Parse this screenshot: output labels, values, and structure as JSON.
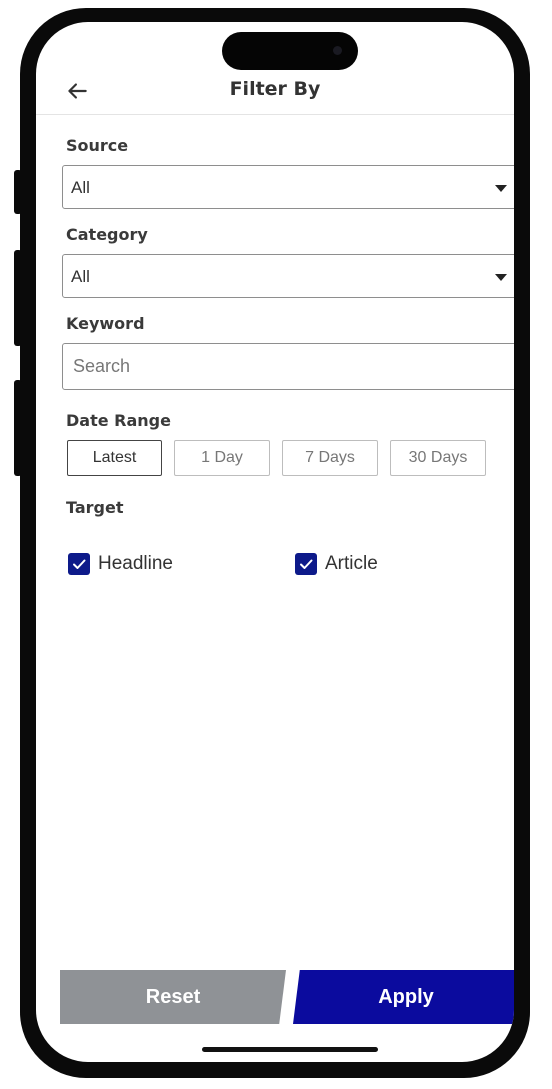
{
  "header": {
    "title": "Filter By",
    "back_icon": "arrow-left-icon"
  },
  "source": {
    "label": "Source",
    "value": "All"
  },
  "category": {
    "label": "Category",
    "value": "All"
  },
  "keyword": {
    "label": "Keyword",
    "placeholder": "Search",
    "value": ""
  },
  "date_range": {
    "label": "Date Range",
    "options": [
      "Latest",
      "1 Day",
      "7 Days",
      "30 Days"
    ],
    "selected": "Latest"
  },
  "target": {
    "label": "Target",
    "options": [
      {
        "label": "Headline",
        "checked": true
      },
      {
        "label": "Article",
        "checked": true
      }
    ]
  },
  "actions": {
    "reset_label": "Reset",
    "apply_label": "Apply"
  },
  "colors": {
    "primary": "#0b0b9e",
    "secondary": "#8f9296",
    "checkbox": "#0d1a8a"
  }
}
